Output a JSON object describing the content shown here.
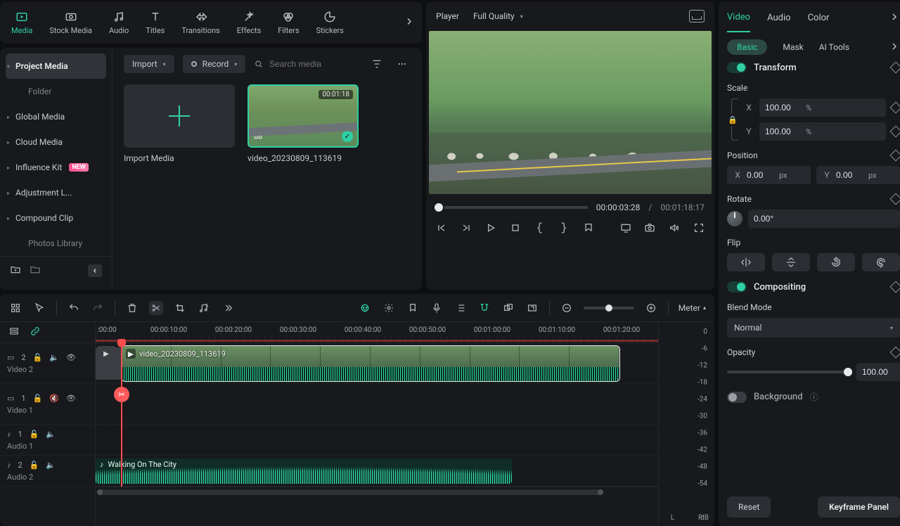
{
  "topTabs": {
    "media": "Media",
    "stock": "Stock Media",
    "audio": "Audio",
    "titles": "Titles",
    "transitions": "Transitions",
    "effects": "Effects",
    "filters": "Filters",
    "stickers": "Stickers"
  },
  "mediaSide": {
    "project": "Project Media",
    "folder": "Folder",
    "global": "Global Media",
    "cloud": "Cloud Media",
    "influence": "Influence Kit",
    "newBadge": "NEW",
    "adjust": "Adjustment L...",
    "compound": "Compound Clip",
    "photos": "Photos Library"
  },
  "mediaToolbar": {
    "import": "Import",
    "record": "Record",
    "searchPlaceholder": "Search media"
  },
  "mediaGrid": {
    "importLabel": "Import Media",
    "clip1": {
      "name": "video_20230809_113619",
      "duration": "00:01:18"
    }
  },
  "player": {
    "title": "Player",
    "quality": "Full Quality",
    "current": "00:00:03:28",
    "sep": "/",
    "total": "00:01:18:17"
  },
  "inspector": {
    "tabs": {
      "video": "Video",
      "audio": "Audio",
      "color": "Color"
    },
    "subtabs": {
      "basic": "Basic",
      "mask": "Mask",
      "ai": "AI Tools"
    },
    "transform": "Transform",
    "scale": "Scale",
    "scaleX": "100.00",
    "scaleY": "100.00",
    "pct": "%",
    "position": "Position",
    "posX": "0.00",
    "posY": "0.00",
    "px": "px",
    "rotate": "Rotate",
    "rotVal": "0.00°",
    "flip": "Flip",
    "compositing": "Compositing",
    "blend": "Blend Mode",
    "blendVal": "Normal",
    "opacity": "Opacity",
    "opacityVal": "100.00",
    "background": "Background",
    "reset": "Reset",
    "keyframe": "Keyframe Panel",
    "x": "X",
    "y": "Y"
  },
  "timeline": {
    "meter": "Meter",
    "ticks": [
      ":00:00",
      "00:00:10:00",
      "00:00:20:00",
      "00:00:30:00",
      "00:00:40:00",
      "00:00:50:00",
      "00:01:00:00",
      "00:01:10:00",
      "00:01:20:00"
    ],
    "tracks": {
      "v2": "Video 2",
      "v1": "Video 1",
      "a1": "Audio 1",
      "a2": "Audio 2",
      "v2n": "2",
      "v1n": "1",
      "a1n": "1",
      "a2n": "2"
    },
    "clipVideo": "video_20230809_113619",
    "clipAudio": "Walking On The City",
    "meterScale": [
      "0",
      "-6",
      "-12",
      "-18",
      "-24",
      "-30",
      "-36",
      "-42",
      "-48",
      "-54"
    ],
    "L": "L",
    "R": "R",
    "dB": "dB"
  }
}
